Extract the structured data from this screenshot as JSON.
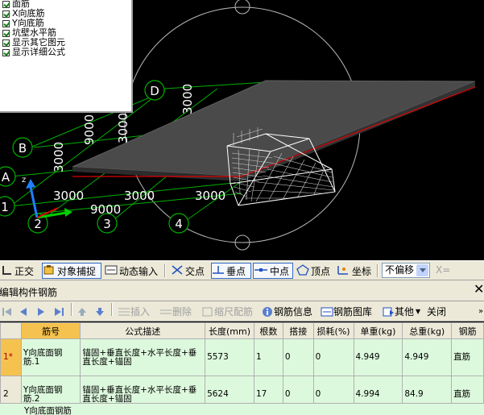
{
  "layers": {
    "items": [
      {
        "label": "面筋",
        "checked": true
      },
      {
        "label": "X向底筋",
        "checked": true
      },
      {
        "label": "Y向底筋",
        "checked": true
      },
      {
        "label": "坑壁水平筋",
        "checked": true
      },
      {
        "label": "显示其它图元",
        "checked": true
      },
      {
        "label": "显示详细公式",
        "checked": true
      }
    ]
  },
  "viewport": {
    "axis_labels": {
      "D": "D",
      "B": "B",
      "A": "A",
      "n1": "1",
      "n2": "2",
      "n3": "3",
      "n4": "4"
    },
    "dimensions": {
      "d1": "3000",
      "d2": "3000",
      "d3": "3000",
      "d4": "9000",
      "v1": "3000",
      "v2": "3000",
      "v3": "9000",
      "v4": "3000"
    },
    "colors": {
      "grid": "#00c000",
      "slab": "#4a4a4a",
      "edge_red": "#e00000",
      "circle": "#c8c8c8"
    }
  },
  "snapbar": {
    "orthogonal": "正交",
    "object_snap": "对象捕捉",
    "dynamic_input": "动态输入",
    "intersection": "交点",
    "perpendicular": "垂点",
    "midpoint": "中点",
    "vertex": "顶点",
    "coordinate": "坐标",
    "offset_value": "不偏移",
    "x_label": "X="
  },
  "panel": {
    "title": "编辑构件钢筋",
    "close": "✕"
  },
  "rebar_toolbar": {
    "insert": "插入",
    "delete": "删除",
    "scale_config": "缩尺配筋",
    "rebar_info": "钢筋信息",
    "rebar_library": "钢筋图库",
    "other": "其他",
    "close": "关闭"
  },
  "table": {
    "headers": [
      "筋号",
      "公式描述",
      "长度(mm)",
      "根数",
      "搭接",
      "损耗(%)",
      "单重(kg)",
      "总重(kg)",
      "钢筋"
    ],
    "rows": [
      {
        "rownum": "1*",
        "name": "Y向底面钢筋.1",
        "formula": "锚固+垂直长度+水平长度+垂直长度+锚固",
        "length": "5573",
        "count": "1",
        "lap": "0",
        "loss": "0",
        "unit_weight": "4.949",
        "total_weight": "4.949",
        "type": "直筋"
      },
      {
        "rownum": "2",
        "name": "Y向底面钢筋.2",
        "formula": "锚固+垂直长度+水平长度+垂直长度+锚固",
        "length": "5624",
        "count": "17",
        "lap": "0",
        "loss": "0",
        "unit_weight": "4.994",
        "total_weight": "84.9",
        "type": "直筋"
      }
    ],
    "partial_row_name": "Y向底面钢筋"
  }
}
